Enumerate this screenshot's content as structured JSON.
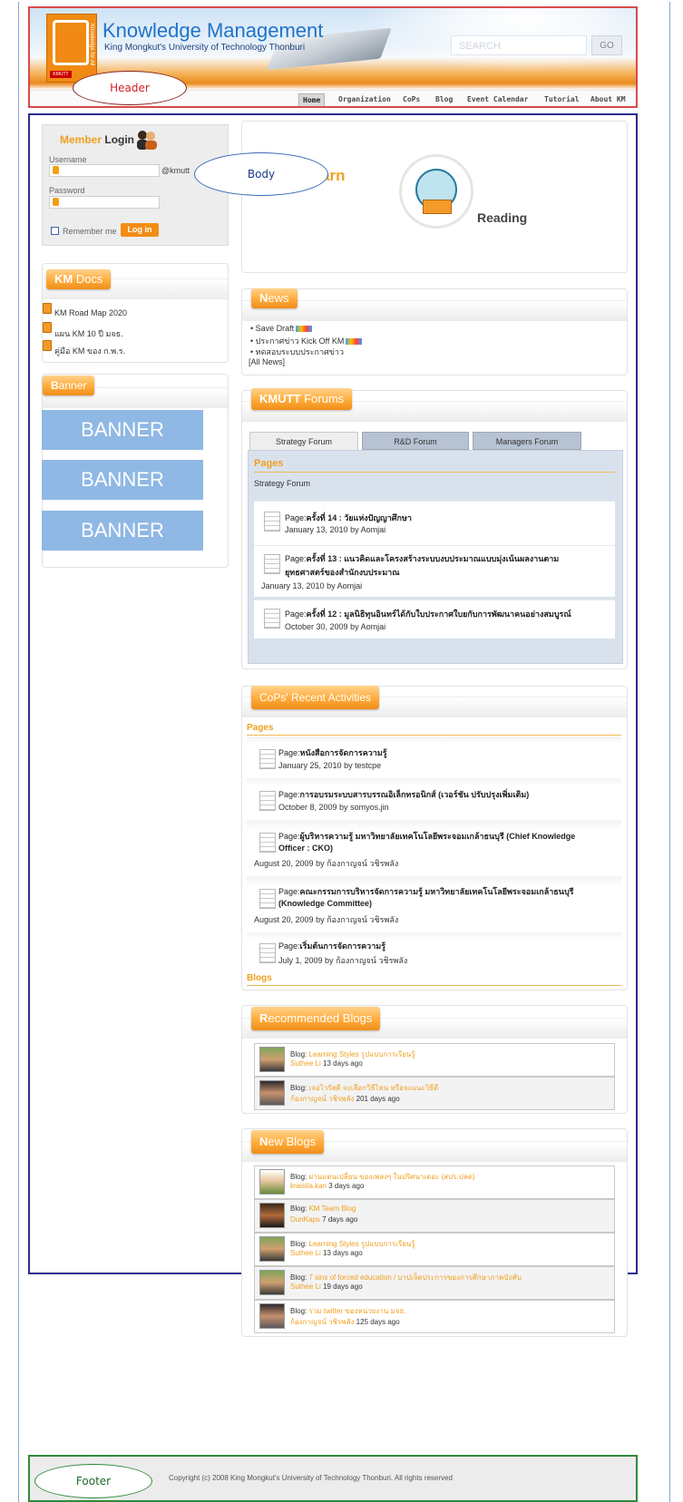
{
  "header": {
    "title": "Knowledge Management",
    "subtitle": "King Mongkut's University of Technology Thonburi",
    "logo_vertical_text": "Knowledge for All",
    "logo_tag": "KMUTT",
    "search_placeholder": "SEARCH",
    "go_label": "GO",
    "nav": [
      "Home",
      "Organization",
      "CoPs",
      "Blog",
      "Event Calendar",
      "Tutorial",
      "About KM"
    ],
    "callout": "Header"
  },
  "body_callout": "Body",
  "footer_callout": "Footer",
  "login": {
    "title_part1": "Member",
    "title_part2": "Login",
    "username_label": "Username",
    "username_suffix": "@kmutt",
    "password_label": "Password",
    "remember_label": "Remember me",
    "login_button": "Log in"
  },
  "km_docs": {
    "heading_bold": "KM",
    "heading_rest": " Docs",
    "items": [
      "KM Road Map 2020",
      "แผน KM 10 ปี มจธ.",
      "คู่มือ KM ของ ก.พ.ร."
    ]
  },
  "banner_section": {
    "heading_bold": "B",
    "heading_rest": "anner",
    "banners": [
      "BANNER",
      "BANNER",
      "BANNER"
    ]
  },
  "featured": {
    "left_text": "arn",
    "reading_label": "Reading"
  },
  "news": {
    "heading_bold": "N",
    "heading_rest": "ews",
    "items": [
      "Save Draft",
      "ประกาศข่าว Kick Off KM",
      "ทดสอบระบบประกาศข่าว"
    ],
    "all_link": "[All News]"
  },
  "forums": {
    "heading_bold": "KMUTT",
    "heading_rest": " Forums",
    "tabs": [
      "Strategy Forum",
      "R&D Forum",
      "Managers Forum"
    ],
    "pages_heading": "Pages",
    "forum_name": "Strategy Forum",
    "posts": [
      {
        "prefix": "Page:",
        "title": "ครั้งที่ 14 : วัยแห่งปัญญาศึกษา",
        "title2": "",
        "date": "January 13, 2010",
        "author": "Aomjai"
      },
      {
        "prefix": "Page:",
        "title": "ครั้งที่ 13 : แนวคิดและโครงสร้างระบบงบประมาณแบบมุ่งเน้นผลงานตาม",
        "title2": "ยุทธศาสตร์ของสำนักงบประมาณ",
        "date": "January 13, 2010",
        "author": "Aomjai"
      },
      {
        "prefix": "Page:",
        "title": "ครั้งที่ 12 : มูลนิธิทุนอินทร์ได้กับใบประกาศใบยกับการพัฒนาคนอย่างสมบูรณ์",
        "title2": "",
        "date": "October 30, 2009",
        "author": "Aomjai"
      }
    ]
  },
  "cops": {
    "heading": "CoPs' Recent Activities",
    "pages_heading": "Pages",
    "blogs_heading": "Blogs",
    "posts": [
      {
        "prefix": "Page:",
        "title": "หนังสือการจัดการความรู้",
        "title2": "",
        "date": "January 25, 2010",
        "author": "testcpe"
      },
      {
        "prefix": "Page:",
        "title": "การอบรมระบบสารบรรณอิเล็กทรอนิกส์ (เวอร์ชัน ปรับปรุงเพิ่มเติม)",
        "title2": "",
        "date": "October 8, 2009",
        "author": "somyos.jin"
      },
      {
        "prefix": "Page:",
        "title": "ผู้บริหารความรู้ มหาวิทยาลัยเทคโนโลยีพระจอมเกล้าธนบุรี (Chief Knowledge",
        "title2": "Officer : CKO)",
        "date": "August 20, 2009",
        "author": "ก้องกาญจน์ วชิรพลัง"
      },
      {
        "prefix": "Page:",
        "title": "คณะกรรมการบริหารจัดการความรู้ มหาวิทยาลัยเทคโนโลยีพระจอมเกล้าธนบุรี",
        "title2": "(Knowledge Committee)",
        "date": "August 20, 2009",
        "author": "ก้องกาญจน์ วชิรพลัง"
      },
      {
        "prefix": "Page:",
        "title": "เริ่มต้นการจัดการความรู้",
        "title2": "",
        "date": "July 1, 2009",
        "author": "ก้องกาญจน์ วชิรพลัง"
      }
    ]
  },
  "recommended_blogs": {
    "heading_bold": "R",
    "heading_rest": "ecommended Blogs",
    "items": [
      {
        "label": "Blog:",
        "title": "Learning Styles รูปแบบการเรียนรู้",
        "author": "Suthee Li",
        "ago": "13 days ago"
      },
      {
        "label": "Blog:",
        "title": "เจอไวรัสดี จะเลือกวิธีไหน หรือจะแนะวิธีดี",
        "author": "ก้องกาญจน์ วชิรพลัง",
        "ago": "201 days ago"
      }
    ]
  },
  "new_blogs": {
    "heading_bold": "N",
    "heading_rest": "ew Blogs",
    "items": [
      {
        "label": "Blog:",
        "title": "ผ่านแดนเปลี่ยน ของเพลงๆ ในปริศนาเดอะ (สปร.ปลด)",
        "author": "kraisila.kan",
        "ago": "3 days ago"
      },
      {
        "label": "Blog:",
        "title": "KM Team Blog",
        "author": "DunKaps",
        "ago": "7 days ago"
      },
      {
        "label": "Blog:",
        "title": "Learning Styles รูปแบบการเรียนรู้",
        "author": "Suthee Li",
        "ago": "13 days ago"
      },
      {
        "label": "Blog:",
        "title": "7 sins of forced education / บาปเจ็ดประการของการศึกษาภาคบังคับ",
        "author": "Suthee Li",
        "ago": "19 days ago"
      },
      {
        "label": "Blog:",
        "title": "รวม twitter ของหน่วยงาน มจธ.",
        "author": "ก้องกาญจน์ วชิรพลัง",
        "ago": "125 days ago"
      }
    ]
  },
  "footer": {
    "copyright": "Copyright (c) 2008 King Mongkut's University of Technology Thonburi. All rights reserved"
  },
  "colors": {
    "accent_orange": "#f0a020",
    "header_border": "#d84a4a",
    "body_border": "#2b2b8e",
    "footer_border": "#2e8a3a",
    "title_blue": "#1f73c9",
    "banner_blue": "#8fb8e4"
  }
}
